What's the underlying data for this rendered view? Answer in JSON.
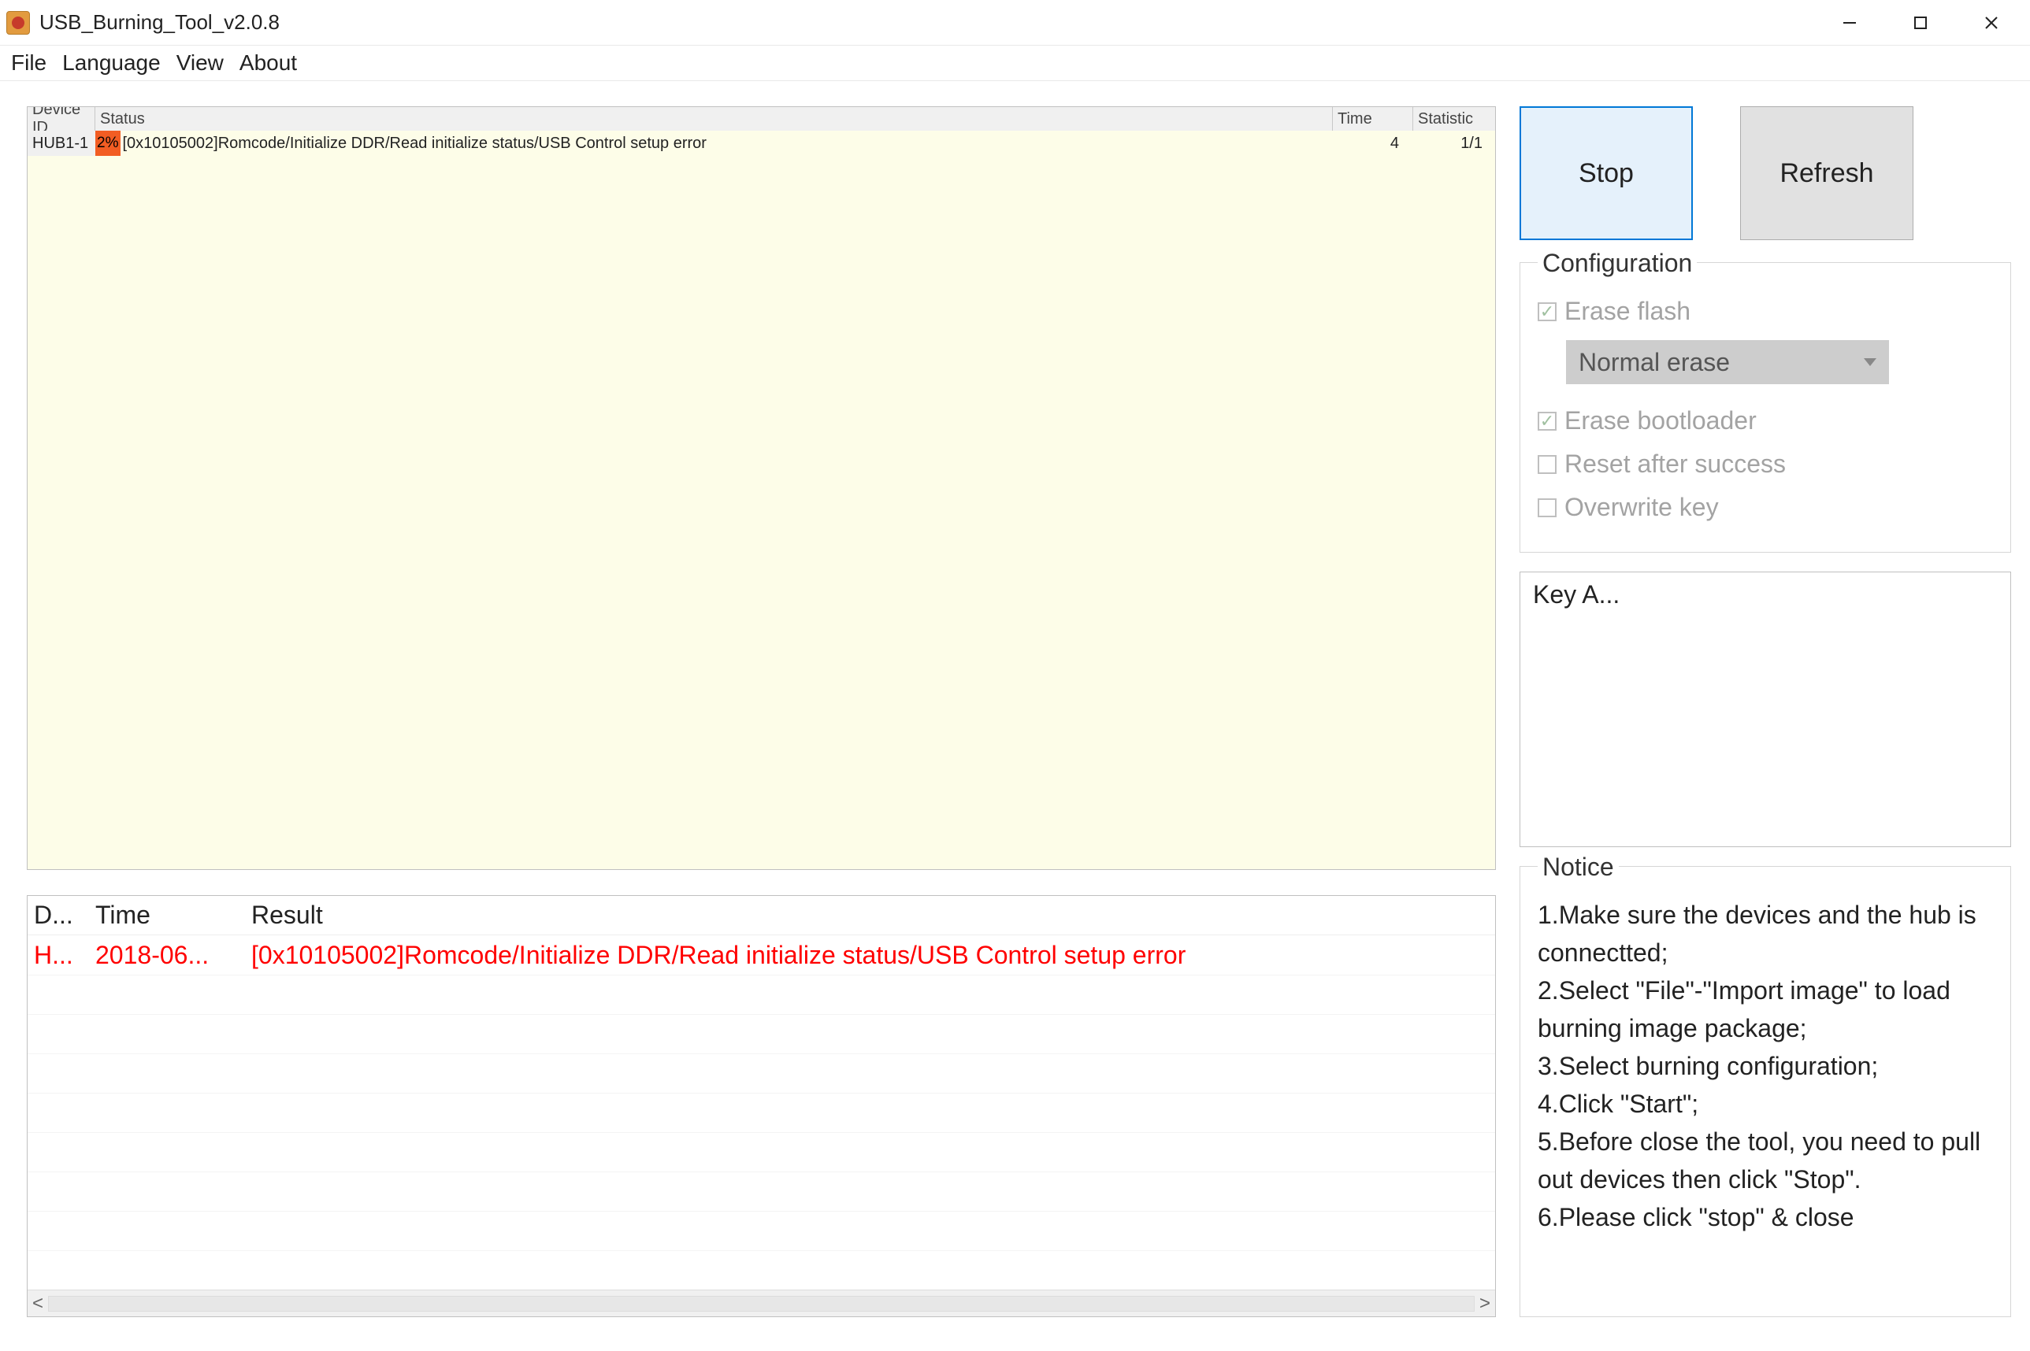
{
  "window": {
    "title": "USB_Burning_Tool_v2.0.8"
  },
  "menubar": [
    "File",
    "Language",
    "View",
    "About"
  ],
  "device_table": {
    "headers": {
      "device": "Device ID",
      "status": "Status",
      "time": "Time",
      "stat": "Statistic"
    },
    "rows": [
      {
        "device": "HUB1-1",
        "progress": "2%",
        "status": "[0x10105002]Romcode/Initialize DDR/Read initialize status/USB Control setup error",
        "time": "4",
        "stat": "1/1"
      }
    ]
  },
  "log_table": {
    "headers": {
      "d": "D...",
      "t": "Time",
      "r": "Result"
    },
    "rows": [
      {
        "d": "H...",
        "t": "2018-06...",
        "r": "[0x10105002]Romcode/Initialize DDR/Read initialize status/USB Control setup error"
      }
    ]
  },
  "buttons": {
    "stop": "Stop",
    "refresh": "Refresh"
  },
  "config": {
    "title": "Configuration",
    "erase_flash": "Erase flash",
    "erase_mode": "Normal erase",
    "erase_bootloader": "Erase bootloader",
    "reset_after": "Reset after success",
    "overwrite_key": "Overwrite key"
  },
  "keybox": {
    "label": "Key A..."
  },
  "notice": {
    "title": "Notice",
    "lines": [
      "1.Make sure the devices and the hub is connectted;",
      "2.Select \"File\"-\"Import image\" to load burning image package;",
      "3.Select burning configuration;",
      "4.Click \"Start\";",
      "5.Before close the tool, you need to pull out devices then click \"Stop\".",
      "6.Please click \"stop\" & close"
    ]
  }
}
